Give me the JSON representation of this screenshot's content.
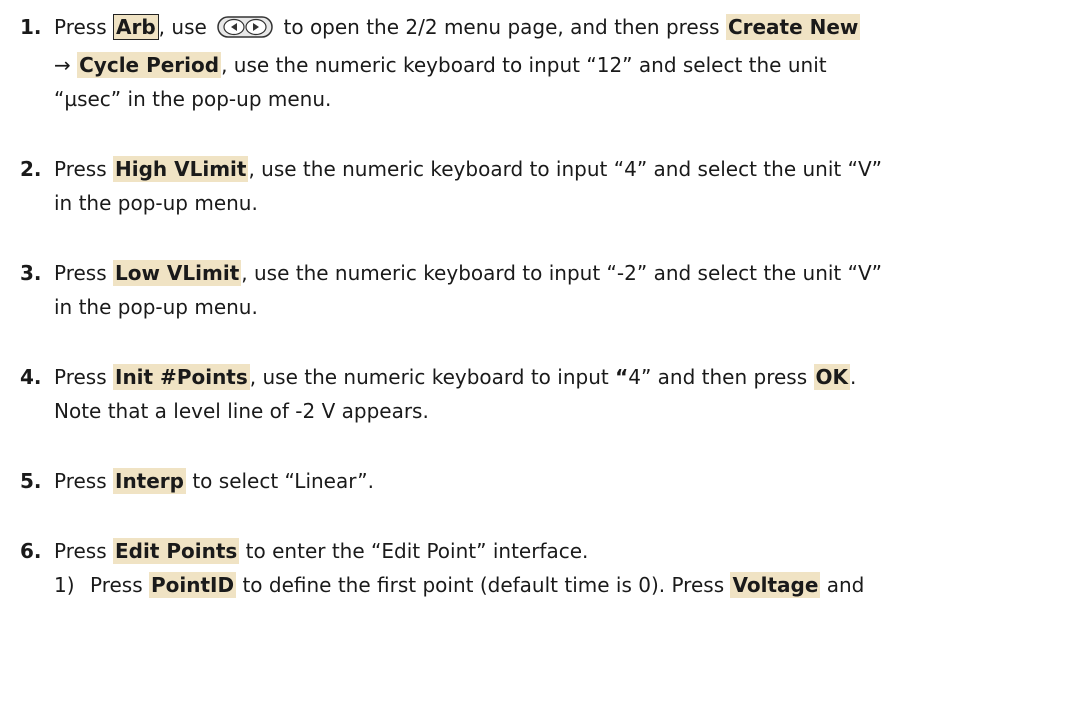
{
  "steps": [
    {
      "num": "1.",
      "t1": "Press ",
      "key_arb": "Arb",
      "t2": ", use ",
      "t3": " to open the 2/2 menu page, and then press ",
      "key_create": "Create New",
      "arrow": "→ ",
      "key_cycle": "Cycle Period",
      "t4": ", use the numeric keyboard to input “12” and select the unit",
      "t5": "“µsec” in the pop-up menu."
    },
    {
      "num": "2.",
      "t1": "Press ",
      "key": "High VLimit",
      "t2": ", use the numeric keyboard to input “4” and select the unit “V”",
      "t3": "in the pop-up menu."
    },
    {
      "num": "3.",
      "t1": "Press ",
      "key": "Low VLimit",
      "t2": ", use the numeric keyboard to input “-2” and select the unit “V”",
      "t3": "in the pop-up menu."
    },
    {
      "num": "4.",
      "t1": "Press ",
      "key": "Init #Points",
      "t2": ", use the numeric keyboard to input ",
      "t2b": "“",
      "t2c": "4” and then press ",
      "key2": "OK",
      "t3": ".",
      "t4": "Note that a level line of -2 V appears."
    },
    {
      "num": "5.",
      "t1": "Press ",
      "key": "Interp",
      "t2": " to select “Linear”."
    },
    {
      "num": "6.",
      "t1": "Press ",
      "key": "Edit Points",
      "t2": " to enter the “Edit Point” interface."
    }
  ],
  "substep": {
    "num": "1)",
    "t1": "Press ",
    "key": "PointID",
    "t2": " to define the first point (default time is 0). Press ",
    "key2": "Voltage",
    "t3": " and"
  },
  "colors": {
    "key_highlight": "#f0e3c4",
    "text": "#1a1a1a"
  },
  "icons": [
    "left-right-arrow-keys-icon"
  ]
}
